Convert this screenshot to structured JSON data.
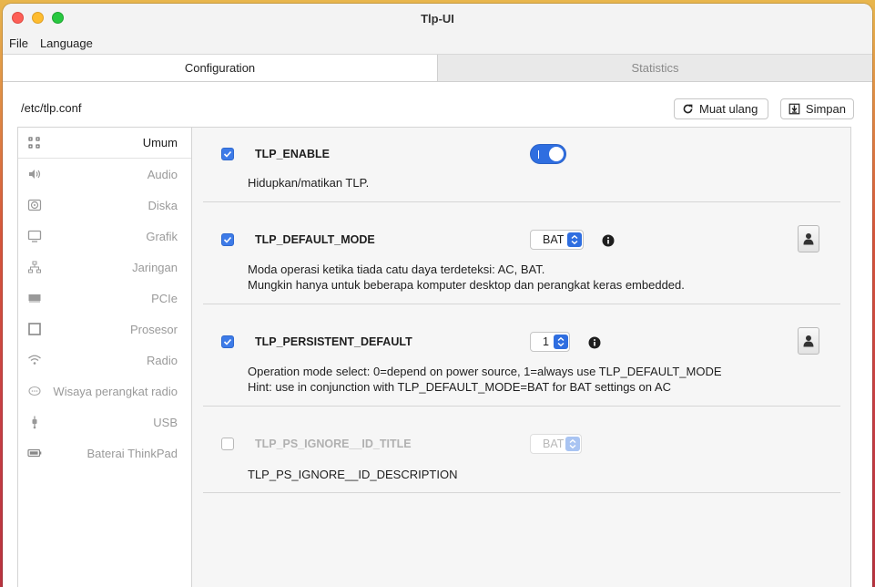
{
  "window": {
    "title": "Tlp-UI"
  },
  "menu": {
    "items": [
      "File",
      "Language"
    ]
  },
  "tabs": [
    {
      "label": "Configuration",
      "active": true
    },
    {
      "label": "Statistics",
      "active": false
    }
  ],
  "path": {
    "label": "/etc/tlp.conf"
  },
  "actions": {
    "reload_label": "Muat ulang",
    "save_label": "Simpan"
  },
  "sidebar": {
    "items": [
      {
        "label": "Umum",
        "icon": "grid-icon",
        "active": true
      },
      {
        "label": "Audio",
        "icon": "speaker-icon"
      },
      {
        "label": "Diska",
        "icon": "disk-icon"
      },
      {
        "label": "Grafik",
        "icon": "monitor-icon"
      },
      {
        "label": "Jaringan",
        "icon": "network-icon"
      },
      {
        "label": "PCIe",
        "icon": "pcie-icon"
      },
      {
        "label": "Prosesor",
        "icon": "processor-icon"
      },
      {
        "label": "Radio",
        "icon": "wifi-icon"
      },
      {
        "label": "Wisaya perangkat radio",
        "icon": "bubble-icon"
      },
      {
        "label": "USB",
        "icon": "usb-icon"
      },
      {
        "label": "Baterai ThinkPad",
        "icon": "battery-icon"
      }
    ]
  },
  "settings": [
    {
      "name": "TLP_ENABLE",
      "checked": true,
      "control": "toggle",
      "toggle_on": true,
      "description": [
        "Hidupkan/matikan TLP."
      ]
    },
    {
      "name": "TLP_DEFAULT_MODE",
      "checked": true,
      "control": "select",
      "value": "BAT",
      "description": [
        "Moda operasi ketika tiada catu daya terdeteksi: AC, BAT.",
        "Mungkin hanya untuk beberapa komputer desktop dan perangkat keras embedded."
      ]
    },
    {
      "name": "TLP_PERSISTENT_DEFAULT",
      "checked": true,
      "control": "select",
      "value": "1",
      "description": [
        "Operation mode select: 0=depend on power source, 1=always use TLP_DEFAULT_MODE",
        "Hint: use in conjunction with TLP_DEFAULT_MODE=BAT for BAT settings on AC"
      ]
    },
    {
      "name": "TLP_PS_IGNORE__ID_TITLE",
      "checked": false,
      "control": "select",
      "value": "BAT",
      "description": [
        "TLP_PS_IGNORE__ID_DESCRIPTION"
      ]
    }
  ],
  "colors": {
    "accent": "#2f6ee0",
    "checkbox": "#3d7be8"
  }
}
